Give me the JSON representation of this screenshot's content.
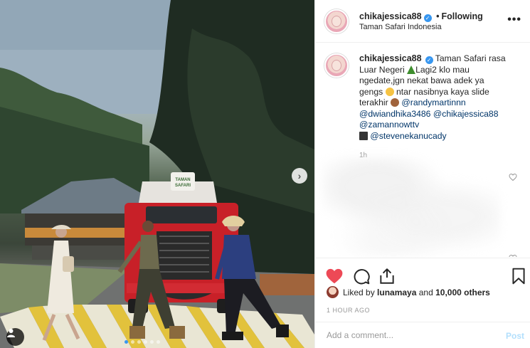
{
  "post": {
    "author": "chikajessica88",
    "follow_separator": "•",
    "follow_status": "Following",
    "location": "Taman Safari Indonesia",
    "more_label": "•••"
  },
  "photo": {
    "truck_sign": [
      "TAMAN",
      "SAFARI"
    ],
    "next_icon": "chevron-right-icon",
    "tag_icon": "user-icon",
    "carousel_dots": 6,
    "active_dot": 0
  },
  "caption": {
    "author": "chikajessica88",
    "text_1": "Taman Safari rasa Luar Negeri",
    "text_2": "Lagi2 klo mau ngedate,jgn nekat bawa adek ya gengs",
    "text_3": "ntar nasibnya kaya slide terakhir",
    "mention_1": "@randymartinnn",
    "mention_2": "@dwiandhika3486",
    "mention_3": "@chikajessica88",
    "mention_4": "@zamannowttv",
    "mention_5": "@stevenekanucady",
    "time": "1h"
  },
  "actions": {
    "like_icon": "heart-filled-icon",
    "comment_icon": "comment-icon",
    "share_icon": "share-icon",
    "save_icon": "bookmark-icon",
    "like_color": "#ed4956"
  },
  "likes": {
    "prefix": "Liked by",
    "user": "lunamaya",
    "middle": "and",
    "others": "10,000 others"
  },
  "posted_time": "1 HOUR AGO",
  "comment_box": {
    "placeholder": "Add a comment...",
    "post_label": "Post"
  }
}
